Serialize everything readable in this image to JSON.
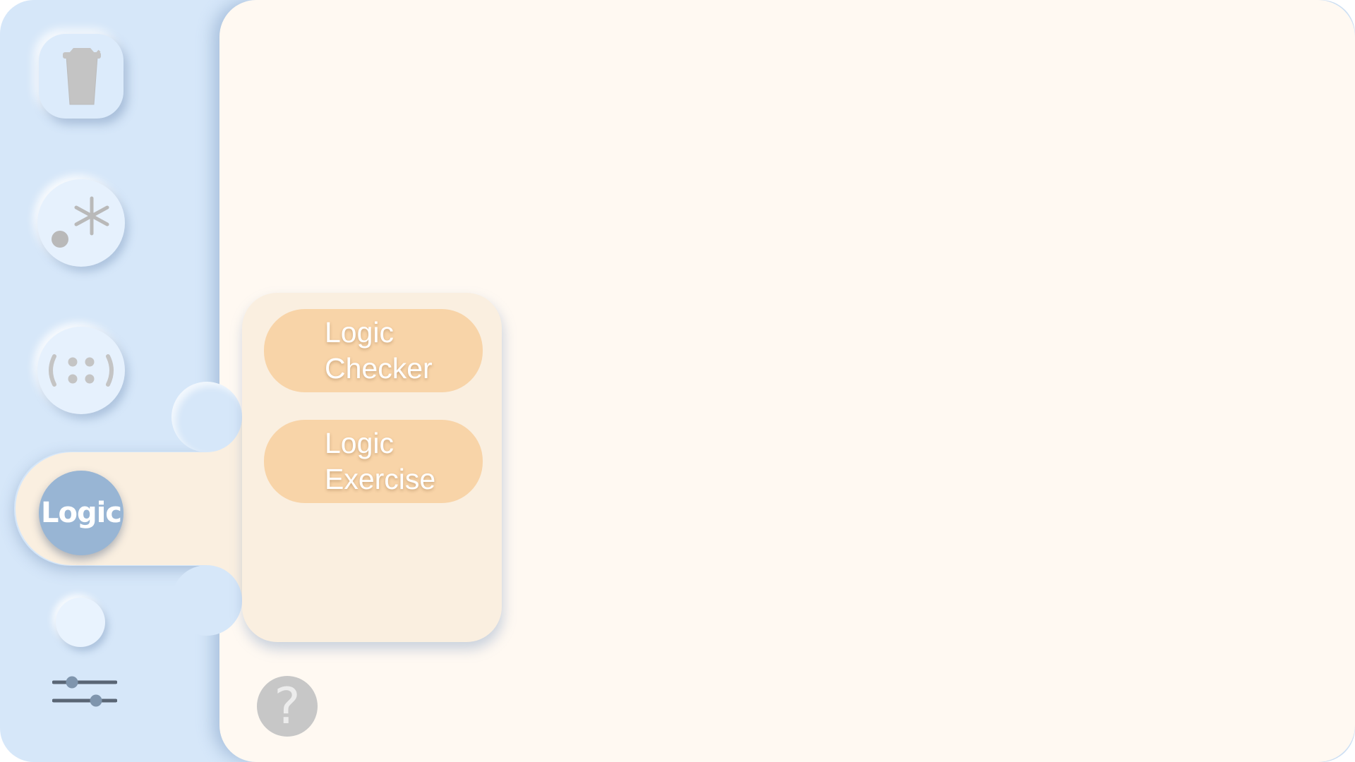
{
  "sidebar": {
    "trash_icon": "trash-icon",
    "regex_icon": "regex-icon",
    "braces_icon": "braces-icon",
    "logic_label": "Logic",
    "blank_button_icon": "circle-icon",
    "settings_icon": "sliders-icon"
  },
  "flyout": {
    "items": [
      {
        "label": "Logic Checker"
      },
      {
        "label": "Logic Exercise"
      }
    ]
  },
  "help": {
    "label": "?"
  },
  "colors": {
    "sidebar_bg": "#d6e7f9",
    "main_bg": "#fff9f2",
    "flyout_bg": "#faefe0",
    "menu_item_bg": "#f8d4a8",
    "logic_button_bg": "#98b5d4",
    "icon_gray": "#b9b9b9"
  }
}
